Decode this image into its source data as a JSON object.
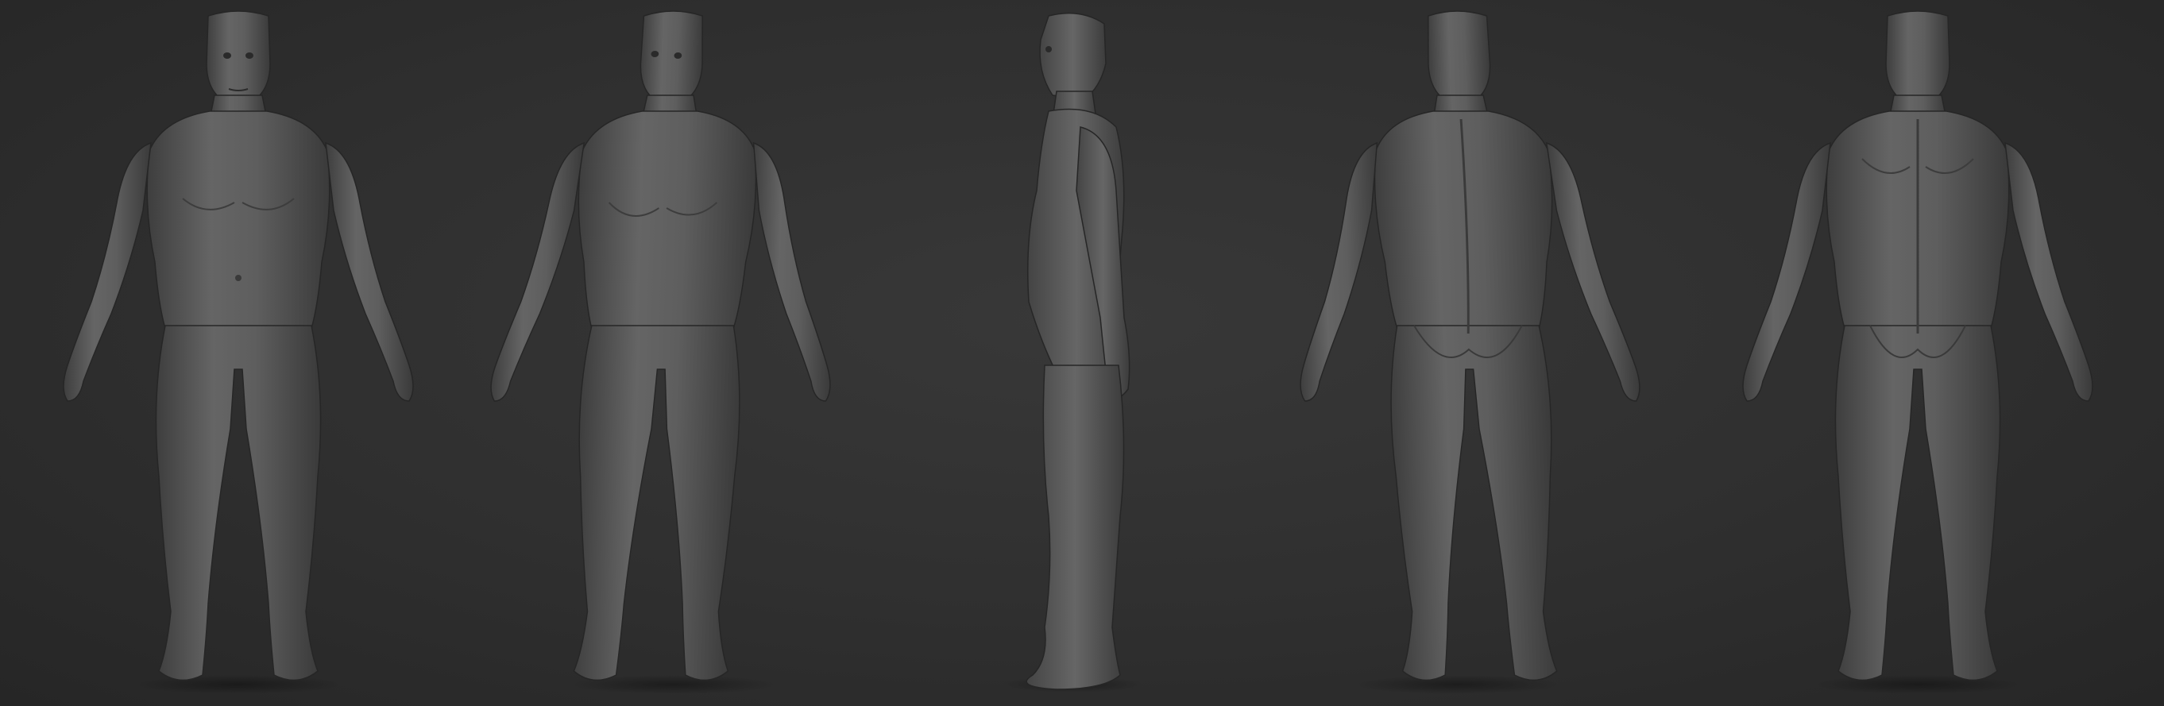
{
  "viewport": {
    "background_color": "#2e2e2e",
    "material_color": "#5a5a5a"
  },
  "views": [
    {
      "id": "front",
      "icon": "figure-front-icon"
    },
    {
      "id": "three-quarter",
      "icon": "figure-three-quarter-icon"
    },
    {
      "id": "side",
      "icon": "figure-side-icon"
    },
    {
      "id": "back-three-quarter",
      "icon": "figure-back-three-quarter-icon"
    },
    {
      "id": "back",
      "icon": "figure-back-icon"
    }
  ]
}
